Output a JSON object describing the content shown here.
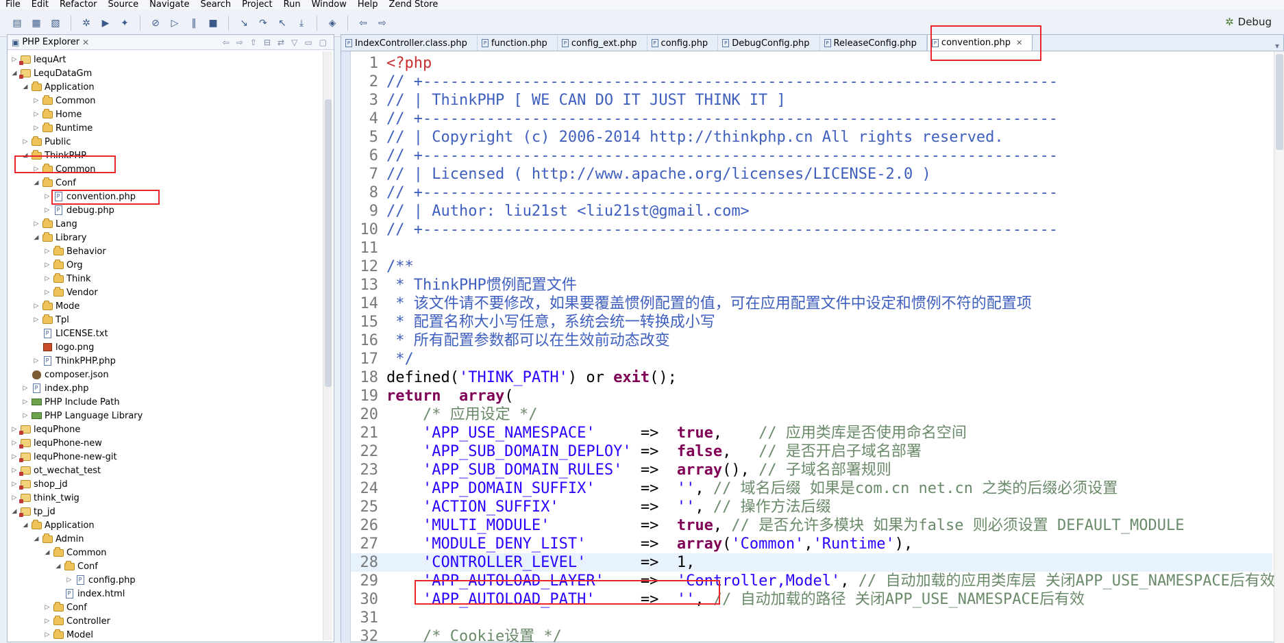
{
  "menu": [
    "File",
    "Edit",
    "Refactor",
    "Source",
    "Navigate",
    "Search",
    "Project",
    "Run",
    "Window",
    "Help",
    "Zend Store"
  ],
  "toolbar_icons": [
    "new-icon",
    "save-icon",
    "save-all-icon",
    "debug-icon",
    "run-icon",
    "external-tools-icon",
    "skip-breakpoints-icon",
    "resume-icon",
    "suspend-icon",
    "terminate-icon",
    "step-into-icon",
    "step-over-icon",
    "step-return-icon",
    "drop-frame-icon",
    "open-type-icon",
    "back-icon",
    "forward-icon"
  ],
  "perspective_label": "Debug",
  "explorer": {
    "title": "PHP Explorer",
    "items": [
      {
        "label": "lequArt",
        "indent": 0,
        "icon": "project",
        "tw": "▷"
      },
      {
        "label": "LequDataGm",
        "indent": 0,
        "icon": "project",
        "tw": "◢"
      },
      {
        "label": "Application",
        "indent": 1,
        "icon": "folder",
        "tw": "◢"
      },
      {
        "label": "Common",
        "indent": 2,
        "icon": "folder",
        "tw": "▷"
      },
      {
        "label": "Home",
        "indent": 2,
        "icon": "folder",
        "tw": "▷"
      },
      {
        "label": "Runtime",
        "indent": 2,
        "icon": "folder",
        "tw": "▷"
      },
      {
        "label": "Public",
        "indent": 1,
        "icon": "folder",
        "tw": "▷"
      },
      {
        "label": "ThinkPHP",
        "indent": 1,
        "icon": "folder",
        "tw": "◢"
      },
      {
        "label": "Common",
        "indent": 2,
        "icon": "folder",
        "tw": "▷"
      },
      {
        "label": "Conf",
        "indent": 2,
        "icon": "folder",
        "tw": "◢"
      },
      {
        "label": "convention.php",
        "indent": 3,
        "icon": "file",
        "tw": "▷"
      },
      {
        "label": "debug.php",
        "indent": 3,
        "icon": "file",
        "tw": "▷"
      },
      {
        "label": "Lang",
        "indent": 2,
        "icon": "folder",
        "tw": "▷"
      },
      {
        "label": "Library",
        "indent": 2,
        "icon": "folder",
        "tw": "◢"
      },
      {
        "label": "Behavior",
        "indent": 3,
        "icon": "folder",
        "tw": "▷"
      },
      {
        "label": "Org",
        "indent": 3,
        "icon": "folder",
        "tw": "▷"
      },
      {
        "label": "Think",
        "indent": 3,
        "icon": "folder",
        "tw": "▷"
      },
      {
        "label": "Vendor",
        "indent": 3,
        "icon": "folder",
        "tw": "▷"
      },
      {
        "label": "Mode",
        "indent": 2,
        "icon": "folder",
        "tw": "▷"
      },
      {
        "label": "Tpl",
        "indent": 2,
        "icon": "folder",
        "tw": "▷"
      },
      {
        "label": "LICENSE.txt",
        "indent": 2,
        "icon": "file",
        "tw": ""
      },
      {
        "label": "logo.png",
        "indent": 2,
        "icon": "img",
        "tw": ""
      },
      {
        "label": "ThinkPHP.php",
        "indent": 2,
        "icon": "file",
        "tw": "▷"
      },
      {
        "label": "composer.json",
        "indent": 1,
        "icon": "json",
        "tw": ""
      },
      {
        "label": "index.php",
        "indent": 1,
        "icon": "file",
        "tw": "▷"
      },
      {
        "label": "PHP Include Path",
        "indent": 1,
        "icon": "lib",
        "tw": "▷"
      },
      {
        "label": "PHP Language Library",
        "indent": 1,
        "icon": "lib",
        "tw": "▷"
      },
      {
        "label": "lequPhone",
        "indent": 0,
        "icon": "project",
        "tw": "▷"
      },
      {
        "label": "lequPhone-new",
        "indent": 0,
        "icon": "project",
        "tw": "▷"
      },
      {
        "label": "lequPhone-new-git",
        "indent": 0,
        "icon": "project",
        "tw": "▷"
      },
      {
        "label": "ot_wechat_test",
        "indent": 0,
        "icon": "project",
        "tw": "▷"
      },
      {
        "label": "shop_jd",
        "indent": 0,
        "icon": "project",
        "tw": "▷"
      },
      {
        "label": "think_twig",
        "indent": 0,
        "icon": "project",
        "tw": "▷"
      },
      {
        "label": "tp_jd",
        "indent": 0,
        "icon": "project",
        "tw": "◢"
      },
      {
        "label": "Application",
        "indent": 1,
        "icon": "folder",
        "tw": "◢"
      },
      {
        "label": "Admin",
        "indent": 2,
        "icon": "folder",
        "tw": "◢"
      },
      {
        "label": "Common",
        "indent": 3,
        "icon": "folder",
        "tw": "◢"
      },
      {
        "label": "Conf",
        "indent": 4,
        "icon": "folder",
        "tw": "◢"
      },
      {
        "label": "config.php",
        "indent": 5,
        "icon": "file",
        "tw": "▷"
      },
      {
        "label": "index.html",
        "indent": 4,
        "icon": "file",
        "tw": ""
      },
      {
        "label": "Conf",
        "indent": 3,
        "icon": "folder",
        "tw": "▷"
      },
      {
        "label": "Controller",
        "indent": 3,
        "icon": "folder",
        "tw": "▷"
      },
      {
        "label": "Model",
        "indent": 3,
        "icon": "folder",
        "tw": "▷"
      }
    ]
  },
  "editor_tabs": [
    {
      "label": "IndexController.class.php",
      "active": false
    },
    {
      "label": "function.php",
      "active": false
    },
    {
      "label": "config_ext.php",
      "active": false
    },
    {
      "label": "config.php",
      "active": false
    },
    {
      "label": "DebugConfig.php",
      "active": false
    },
    {
      "label": "ReleaseConfig.php",
      "active": false
    },
    {
      "label": "convention.php",
      "active": true
    }
  ],
  "code_lines": [
    {
      "n": "1",
      "segs": [
        [
          "tag",
          "<?php"
        ]
      ]
    },
    {
      "n": "2",
      "segs": [
        [
          "com",
          "// +----------------------------------------------------------------------"
        ]
      ]
    },
    {
      "n": "3",
      "segs": [
        [
          "com",
          "// | ThinkPHP [ WE CAN DO IT JUST THINK IT ]"
        ]
      ]
    },
    {
      "n": "4",
      "segs": [
        [
          "com",
          "// +----------------------------------------------------------------------"
        ]
      ]
    },
    {
      "n": "5",
      "segs": [
        [
          "com",
          "// | Copyright (c) 2006-2014 http://thinkphp.cn All rights reserved."
        ]
      ]
    },
    {
      "n": "6",
      "segs": [
        [
          "com",
          "// +----------------------------------------------------------------------"
        ]
      ]
    },
    {
      "n": "7",
      "segs": [
        [
          "com",
          "// | Licensed ( http://www.apache.org/licenses/LICENSE-2.0 )"
        ]
      ]
    },
    {
      "n": "8",
      "segs": [
        [
          "com",
          "// +----------------------------------------------------------------------"
        ]
      ]
    },
    {
      "n": "9",
      "segs": [
        [
          "com",
          "// | Author: liu21st <liu21st@gmail.com>"
        ]
      ]
    },
    {
      "n": "10",
      "segs": [
        [
          "com",
          "// +----------------------------------------------------------------------"
        ]
      ]
    },
    {
      "n": "11",
      "segs": [
        [
          "fn",
          ""
        ]
      ]
    },
    {
      "n": "12",
      "segs": [
        [
          "com",
          "/**"
        ]
      ]
    },
    {
      "n": "13",
      "segs": [
        [
          "com",
          " * ThinkPHP惯例配置文件"
        ]
      ]
    },
    {
      "n": "14",
      "segs": [
        [
          "com",
          " * 该文件请不要修改，如果要覆盖惯例配置的值，可在应用配置文件中设定和惯例不符的配置项"
        ]
      ]
    },
    {
      "n": "15",
      "segs": [
        [
          "com",
          " * 配置名称大小写任意，系统会统一转换成小写"
        ]
      ]
    },
    {
      "n": "16",
      "segs": [
        [
          "com",
          " * 所有配置参数都可以在生效前动态改变"
        ]
      ]
    },
    {
      "n": "17",
      "segs": [
        [
          "com",
          " */"
        ]
      ]
    },
    {
      "n": "18",
      "segs": [
        [
          "fn",
          "defined("
        ],
        [
          "str",
          "'THINK_PATH'"
        ],
        [
          "fn",
          ") or "
        ],
        [
          "kw",
          "exit"
        ],
        [
          "fn",
          "();"
        ]
      ]
    },
    {
      "n": "19",
      "segs": [
        [
          "kw",
          "return  array"
        ],
        [
          "fn",
          "("
        ]
      ]
    },
    {
      "n": "20",
      "segs": [
        [
          "cm",
          "    /* 应用设定 */"
        ]
      ]
    },
    {
      "n": "21",
      "segs": [
        [
          "str",
          "    'APP_USE_NAMESPACE'"
        ],
        [
          "fn",
          "     =>  "
        ],
        [
          "kw",
          "true"
        ],
        [
          "fn",
          ",    "
        ],
        [
          "cm",
          "// 应用类库是否使用命名空间"
        ]
      ]
    },
    {
      "n": "22",
      "segs": [
        [
          "str",
          "    'APP_SUB_DOMAIN_DEPLOY'"
        ],
        [
          "fn",
          " =>  "
        ],
        [
          "kw",
          "false"
        ],
        [
          "fn",
          ",   "
        ],
        [
          "cm",
          "// 是否开启子域名部署"
        ]
      ]
    },
    {
      "n": "23",
      "segs": [
        [
          "str",
          "    'APP_SUB_DOMAIN_RULES'"
        ],
        [
          "fn",
          "  =>  "
        ],
        [
          "kw",
          "array"
        ],
        [
          "fn",
          "(), "
        ],
        [
          "cm",
          "// 子域名部署规则"
        ]
      ]
    },
    {
      "n": "24",
      "segs": [
        [
          "str",
          "    'APP_DOMAIN_SUFFIX'"
        ],
        [
          "fn",
          "     =>  "
        ],
        [
          "str",
          "''"
        ],
        [
          "fn",
          ", "
        ],
        [
          "cm",
          "// 域名后缀 如果是com.cn net.cn 之类的后缀必须设置"
        ]
      ]
    },
    {
      "n": "25",
      "segs": [
        [
          "str",
          "    'ACTION_SUFFIX'"
        ],
        [
          "fn",
          "         =>  "
        ],
        [
          "str",
          "''"
        ],
        [
          "fn",
          ", "
        ],
        [
          "cm",
          "// 操作方法后缀"
        ]
      ]
    },
    {
      "n": "26",
      "segs": [
        [
          "str",
          "    'MULTI_MODULE'"
        ],
        [
          "fn",
          "          =>  "
        ],
        [
          "kw",
          "true"
        ],
        [
          "fn",
          ", "
        ],
        [
          "cm",
          "// 是否允许多模块 如果为false 则必须设置 DEFAULT_MODULE"
        ]
      ]
    },
    {
      "n": "27",
      "segs": [
        [
          "str",
          "    'MODULE_DENY_LIST'"
        ],
        [
          "fn",
          "      =>  "
        ],
        [
          "kw",
          "array"
        ],
        [
          "fn",
          "("
        ],
        [
          "str",
          "'Common'"
        ],
        [
          "fn",
          ","
        ],
        [
          "str",
          "'Runtime'"
        ],
        [
          "fn",
          "),"
        ]
      ]
    },
    {
      "n": "28",
      "segs": [
        [
          "str",
          "    'CONTROLLER_LEVEL'"
        ],
        [
          "fn",
          "      =>  1,"
        ]
      ]
    },
    {
      "n": "29",
      "segs": [
        [
          "str",
          "    'APP_AUTOLOAD_LAYER'"
        ],
        [
          "fn",
          "    =>  "
        ],
        [
          "str",
          "'Controller,Model'"
        ],
        [
          "fn",
          ", "
        ],
        [
          "cm",
          "// 自动加载的应用类库层 关闭APP_USE_NAMESPACE后有效"
        ]
      ]
    },
    {
      "n": "30",
      "segs": [
        [
          "str",
          "    'APP_AUTOLOAD_PATH'"
        ],
        [
          "fn",
          "     =>  "
        ],
        [
          "str",
          "''"
        ],
        [
          "fn",
          ", "
        ],
        [
          "cm",
          "// 自动加载的路径 关闭APP_USE_NAMESPACE后有效"
        ]
      ]
    },
    {
      "n": "31",
      "segs": [
        [
          "fn",
          ""
        ]
      ]
    },
    {
      "n": "32",
      "segs": [
        [
          "cm",
          "    /* Cookie设置 */"
        ]
      ]
    }
  ],
  "colors": {
    "highlight": "#e8262b",
    "comment": "#3f5fbf",
    "keyword": "#7f0055",
    "string": "#2a00ff"
  }
}
